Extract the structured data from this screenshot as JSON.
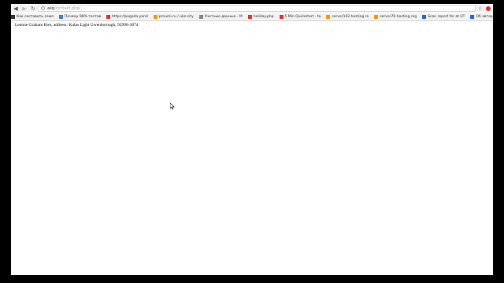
{
  "browser": {
    "address": {
      "host": "asq",
      "path": "/contakt.php/"
    }
  },
  "bookmarks": [
    {
      "label": "Как составить семя",
      "color": "#333333"
    },
    {
      "label": "Почему 98% тестов",
      "color": "#4a7bd0"
    },
    {
      "label": "https://pogoda.yand",
      "color": "#d9363e"
    },
    {
      "label": "prnumi.ru / ukz-city",
      "color": "#e6a100"
    },
    {
      "label": "Учетные данные - M",
      "color": "#888888"
    },
    {
      "label": "holiday.php",
      "color": "#d9363e"
    },
    {
      "label": "5 Min Quickstart - ta",
      "color": "#d9363e"
    },
    {
      "label": "server102.hosting.re",
      "color": "#e6a100"
    },
    {
      "label": "server70.hosting.reg",
      "color": "#e6a100"
    },
    {
      "label": "Scan report for at UT",
      "color": "#2a6ac8"
    },
    {
      "label": "Об авторе проекта",
      "color": "#2a6ac8"
    },
    {
      "label": "",
      "color": "#888888"
    },
    {
      "label": "Объектно-ориенти",
      "color": "#c0392b"
    }
  ],
  "content": {
    "text": "Leanne Graham Bret, address: Kulas Light Gwenborough, 92998-3874"
  },
  "colors": {
    "page": "#ffffff",
    "chrome": "#f2f2f2",
    "frame": "#000000"
  }
}
